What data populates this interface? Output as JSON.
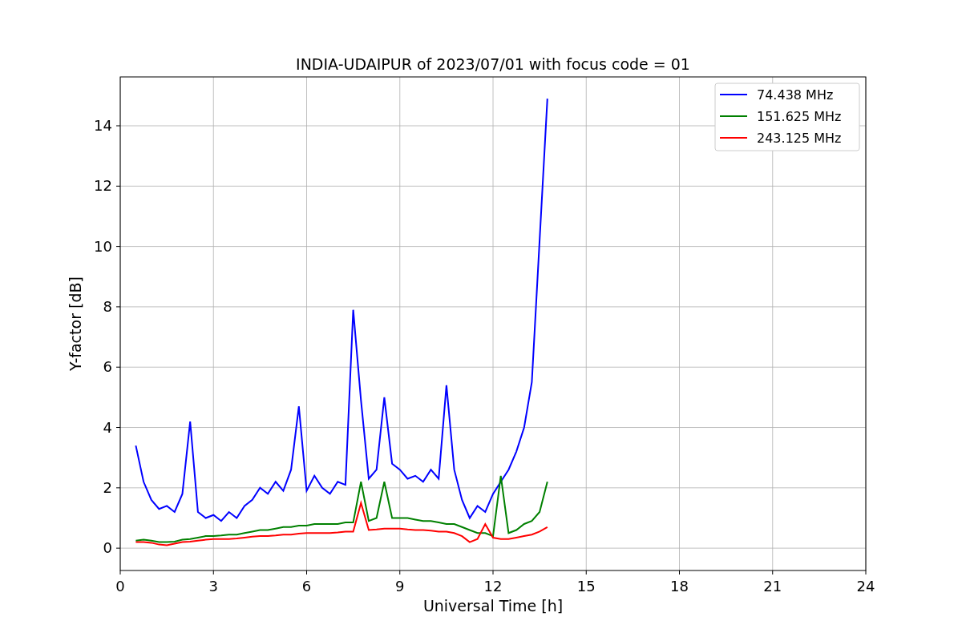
{
  "chart_data": {
    "type": "line",
    "title": "INDIA-UDAIPUR of 2023/07/01 with focus code = 01",
    "xlabel": "Universal Time [h]",
    "ylabel": "Y-factor [dB]",
    "x": [
      0.5,
      0.75,
      1.0,
      1.25,
      1.5,
      1.75,
      2.0,
      2.25,
      2.5,
      2.75,
      3.0,
      3.25,
      3.5,
      3.75,
      4.0,
      4.25,
      4.5,
      4.75,
      5.0,
      5.25,
      5.5,
      5.75,
      6.0,
      6.25,
      6.5,
      6.75,
      7.0,
      7.25,
      7.5,
      7.75,
      8.0,
      8.25,
      8.5,
      8.75,
      9.0,
      9.25,
      9.5,
      9.75,
      10.0,
      10.25,
      10.5,
      10.75,
      11.0,
      11.25,
      11.5,
      11.75,
      12.0,
      12.25,
      12.5,
      12.75,
      13.0,
      13.25,
      13.5,
      13.75
    ],
    "series": [
      {
        "name": "74.438 MHz",
        "color": "#0000ff",
        "values": [
          3.4,
          2.2,
          1.6,
          1.3,
          1.4,
          1.2,
          1.8,
          4.2,
          1.2,
          1.0,
          1.1,
          0.9,
          1.2,
          1.0,
          1.4,
          1.6,
          2.0,
          1.8,
          2.2,
          1.9,
          2.6,
          4.7,
          1.9,
          2.4,
          2.0,
          1.8,
          2.2,
          2.1,
          7.9,
          4.9,
          2.3,
          2.6,
          5.0,
          2.8,
          2.6,
          2.3,
          2.4,
          2.2,
          2.6,
          2.3,
          5.4,
          2.6,
          1.6,
          1.0,
          1.4,
          1.2,
          1.8,
          2.2,
          2.6,
          3.2,
          4.0,
          5.5,
          10.2,
          14.9
        ]
      },
      {
        "name": "151.625 MHz",
        "color": "#008000",
        "values": [
          0.25,
          0.28,
          0.25,
          0.2,
          0.2,
          0.22,
          0.28,
          0.3,
          0.35,
          0.4,
          0.4,
          0.42,
          0.45,
          0.45,
          0.5,
          0.55,
          0.6,
          0.6,
          0.65,
          0.7,
          0.7,
          0.75,
          0.75,
          0.8,
          0.8,
          0.8,
          0.8,
          0.85,
          0.85,
          2.2,
          0.9,
          1.0,
          2.2,
          1.0,
          1.0,
          1.0,
          0.95,
          0.9,
          0.9,
          0.85,
          0.8,
          0.8,
          0.7,
          0.6,
          0.5,
          0.5,
          0.4,
          2.4,
          0.5,
          0.6,
          0.8,
          0.9,
          1.2,
          2.2
        ]
      },
      {
        "name": "243.125 MHz",
        "color": "#ff0000",
        "values": [
          0.2,
          0.2,
          0.18,
          0.12,
          0.1,
          0.15,
          0.2,
          0.22,
          0.25,
          0.28,
          0.3,
          0.3,
          0.3,
          0.32,
          0.35,
          0.38,
          0.4,
          0.4,
          0.42,
          0.45,
          0.45,
          0.48,
          0.5,
          0.5,
          0.5,
          0.5,
          0.52,
          0.55,
          0.55,
          1.5,
          0.6,
          0.62,
          0.65,
          0.65,
          0.65,
          0.62,
          0.6,
          0.6,
          0.58,
          0.55,
          0.55,
          0.5,
          0.4,
          0.2,
          0.3,
          0.8,
          0.35,
          0.3,
          0.3,
          0.35,
          0.4,
          0.45,
          0.55,
          0.7
        ]
      }
    ],
    "xlim": [
      0,
      24
    ],
    "ylim": [
      -0.74,
      15.62
    ],
    "xticks": [
      0,
      3,
      6,
      9,
      12,
      15,
      18,
      21,
      24
    ],
    "yticks": [
      0,
      2,
      4,
      6,
      8,
      10,
      12,
      14
    ],
    "grid": true,
    "legend": true
  }
}
